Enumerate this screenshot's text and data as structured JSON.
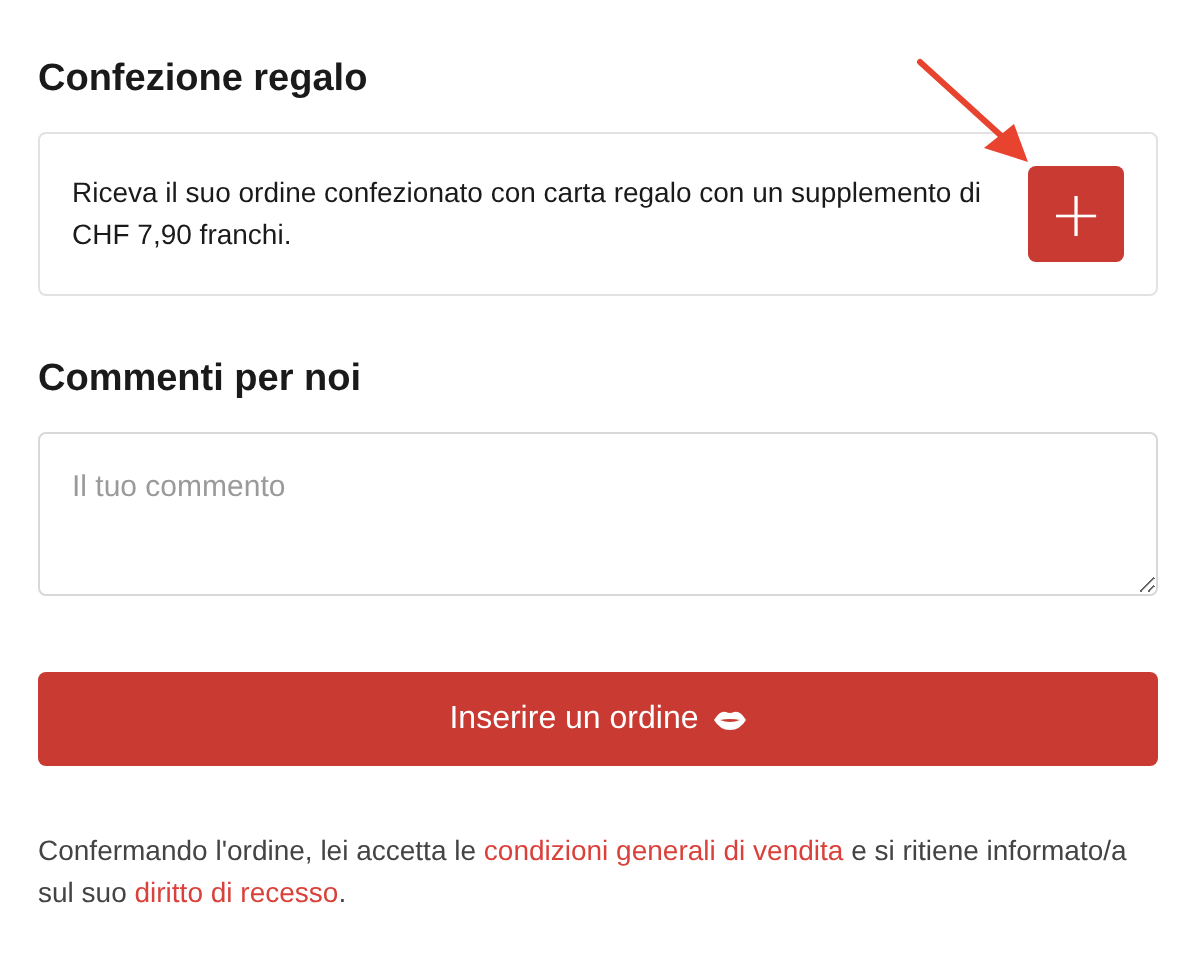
{
  "gift_wrap": {
    "title": "Confezione regalo",
    "description": "Riceva il suo ordine confezionato con carta regalo con un supplemento di CHF 7,90 franchi.",
    "add_button": "+"
  },
  "comments": {
    "title": "Commenti per noi",
    "placeholder": "Il tuo commento"
  },
  "order_button": {
    "label": "Inserire un ordine"
  },
  "legal_note": [
    {
      "kind": "text",
      "text": "Confermando l'ordine, lei accetta le "
    },
    {
      "kind": "link",
      "text": "condizioni generali di vendita"
    },
    {
      "kind": "text",
      "text": " e si ritiene informato/a sul suo "
    },
    {
      "kind": "link",
      "text": "diritto di recesso"
    },
    {
      "kind": "text",
      "text": "."
    }
  ]
}
